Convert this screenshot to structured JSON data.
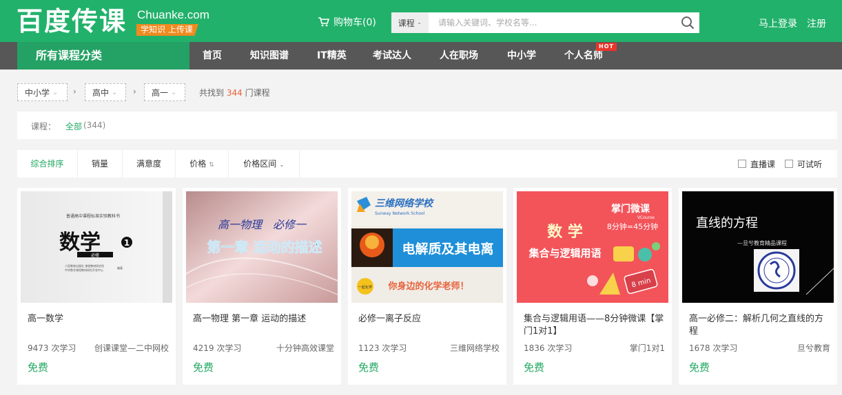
{
  "header": {
    "logo_cn": "百度传课",
    "logo_en": "Chuanke.com",
    "slogan": "学知识 上传课",
    "cart_label": "购物车(0)",
    "search_category": "课程",
    "search_placeholder": "请输入关键词、学校名等...",
    "login": "马上登录",
    "register": "注册"
  },
  "nav": {
    "all_categories": "所有课程分类",
    "items": [
      "首页",
      "知识图谱",
      "IT精英",
      "考试达人",
      "人在职场",
      "中小学",
      "个人名师"
    ],
    "hot_badge": "HOT"
  },
  "breadcrumb": {
    "levels": [
      "中小学",
      "高中",
      "高一"
    ],
    "found_prefix": "共找到",
    "found_count": "344",
    "found_suffix": "门课程"
  },
  "filter": {
    "label": "课程：",
    "all": "全部",
    "count": "(344)"
  },
  "sort": {
    "items": [
      "综合排序",
      "销量",
      "满意度",
      "价格",
      "价格区间"
    ],
    "live": "直播课",
    "trial": "可试听"
  },
  "thumbs": {
    "math_header": "普通高中课程标准实验教科书",
    "math_title": "数学",
    "math_vol": "必修",
    "math_publisher1": "人民教育出版社 课程教材研究所",
    "math_publisher2": "中学数学课程教材研究开发中心",
    "math_publisher3": "编著",
    "physics_line1": "高一物理　必修一",
    "physics_line2": "第一章 运动的描述",
    "chem_brand": "三维网络学校",
    "chem_brand_en": "Sunway Network School",
    "chem_title": "电解质及其电离",
    "chem_bubble": "一起化学",
    "chem_slogan": "你身边的化学老师！",
    "logic_brand": "掌门微课",
    "logic_brand_en": "VCourse",
    "logic_formula": "8分钟=45分钟",
    "logic_subject": "数 学",
    "logic_title": "集合与逻辑用语",
    "logic_clock": "8 min",
    "line_title": "直线的方程",
    "line_sub": "—旦兮教育精品课程"
  },
  "courses": [
    {
      "title": "高一数学",
      "students": "9473 次学习",
      "school": "创课课堂—二中网校",
      "price": "免费"
    },
    {
      "title": "高一物理 第一章 运动的描述",
      "students": "4219 次学习",
      "school": "十分钟高效课堂",
      "price": "免费"
    },
    {
      "title": "必修一离子反应",
      "students": "1123 次学习",
      "school": "三维网络学校",
      "price": "免费"
    },
    {
      "title": "集合与逻辑用语——8分钟微课【掌门1对1】",
      "students": "1836 次学习",
      "school": "掌门1对1",
      "price": "免费"
    },
    {
      "title": "高一必修二：解析几何之直线的方程",
      "students": "1678 次学习",
      "school": "旦兮教育",
      "price": "免费"
    }
  ],
  "colors": {
    "brand_green": "#22b16b",
    "nav_gray": "#575757",
    "accent_orange": "#f08a1e",
    "price_green": "#22a862",
    "hot_red": "#e8352b"
  }
}
